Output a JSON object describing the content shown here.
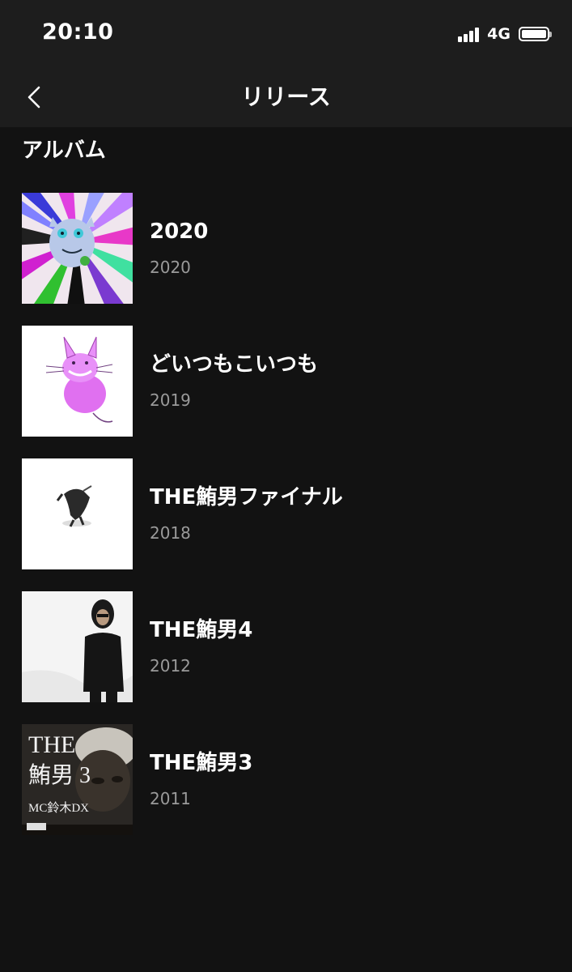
{
  "status_bar": {
    "time": "20:10",
    "network": "4G",
    "battery_level": 1.0
  },
  "nav": {
    "title": "リリース",
    "back_icon": "chevron-left-icon"
  },
  "section": {
    "title": "アルバム"
  },
  "albums": [
    {
      "name": "2020",
      "year": "2020"
    },
    {
      "name": "どいつもこいつも",
      "year": "2019"
    },
    {
      "name": "THE鮪男ファイナル",
      "year": "2018"
    },
    {
      "name": "THE鮪男4",
      "year": "2012"
    },
    {
      "name": "THE鮪男3",
      "year": "2011",
      "cover_text": {
        "line1": "THE",
        "line2": "鮪男 3",
        "line3": "MC鈴木DX"
      }
    }
  ],
  "colors": {
    "background": "#121212",
    "header": "#1d1d1d",
    "text_primary": "#ffffff",
    "text_secondary": "#9a9a9a"
  }
}
